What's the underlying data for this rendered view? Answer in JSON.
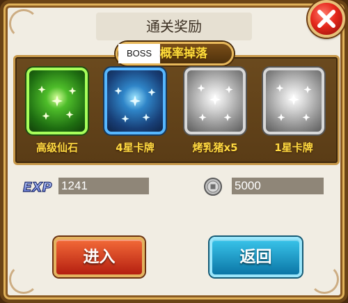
{
  "dialog": {
    "title": "通关奖励",
    "banner_tag": "BOSS",
    "banner_text": "概率掉落"
  },
  "rewards": [
    {
      "label": "高级仙石",
      "rarity_color": "#5fd02f"
    },
    {
      "label": "4星卡牌",
      "rarity_color": "#2f85c8"
    },
    {
      "label": "烤乳猪x5",
      "rarity_color": "#bfbfbf"
    },
    {
      "label": "1星卡牌",
      "rarity_color": "#bfbfbf"
    }
  ],
  "stats": {
    "exp_icon_text": "EXP",
    "exp_value": "1241",
    "coin_value": "5000"
  },
  "buttons": {
    "enter_label": "进入",
    "back_label": "返回"
  },
  "icons": {
    "close": "close-icon",
    "exp": "exp-icon",
    "coin": "coin-icon"
  }
}
